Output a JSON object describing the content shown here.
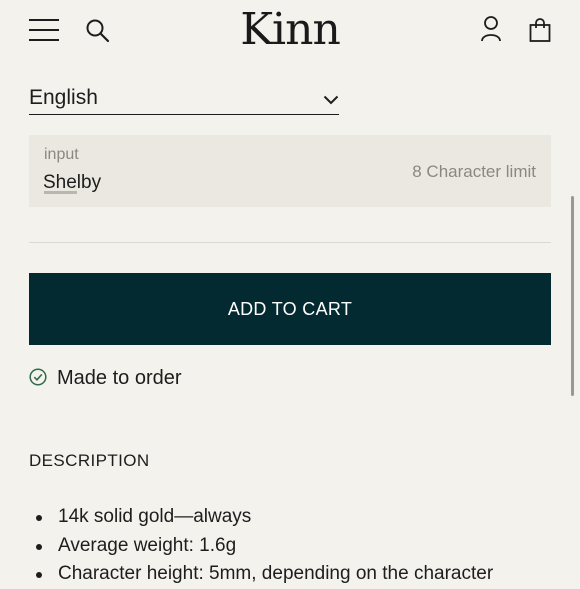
{
  "header": {
    "logo_text": "Kinn",
    "menu_icon": "hamburger-menu-icon",
    "search_icon": "search-icon",
    "account_icon": "account-icon",
    "bag_icon": "shopping-bag-icon"
  },
  "language_select": {
    "selected": "English",
    "icon": "chevron-down-icon"
  },
  "engraving_input": {
    "label": "input",
    "value": "Shelby",
    "limit_text": "8 Character limit"
  },
  "cart": {
    "button_label": "ADD TO CART",
    "button_color": "#042a31"
  },
  "availability": {
    "icon": "check-circle-icon",
    "text": "Made to order",
    "icon_color": "#2f6b4d"
  },
  "description": {
    "heading": "DESCRIPTION",
    "items": [
      "14k solid gold—always",
      "Average weight: 1.6g",
      "Character height: 5mm, depending on the character"
    ]
  },
  "colors": {
    "background": "#f4f2ed",
    "input_background": "#ebe8e1",
    "text": "#1d1d1d"
  }
}
